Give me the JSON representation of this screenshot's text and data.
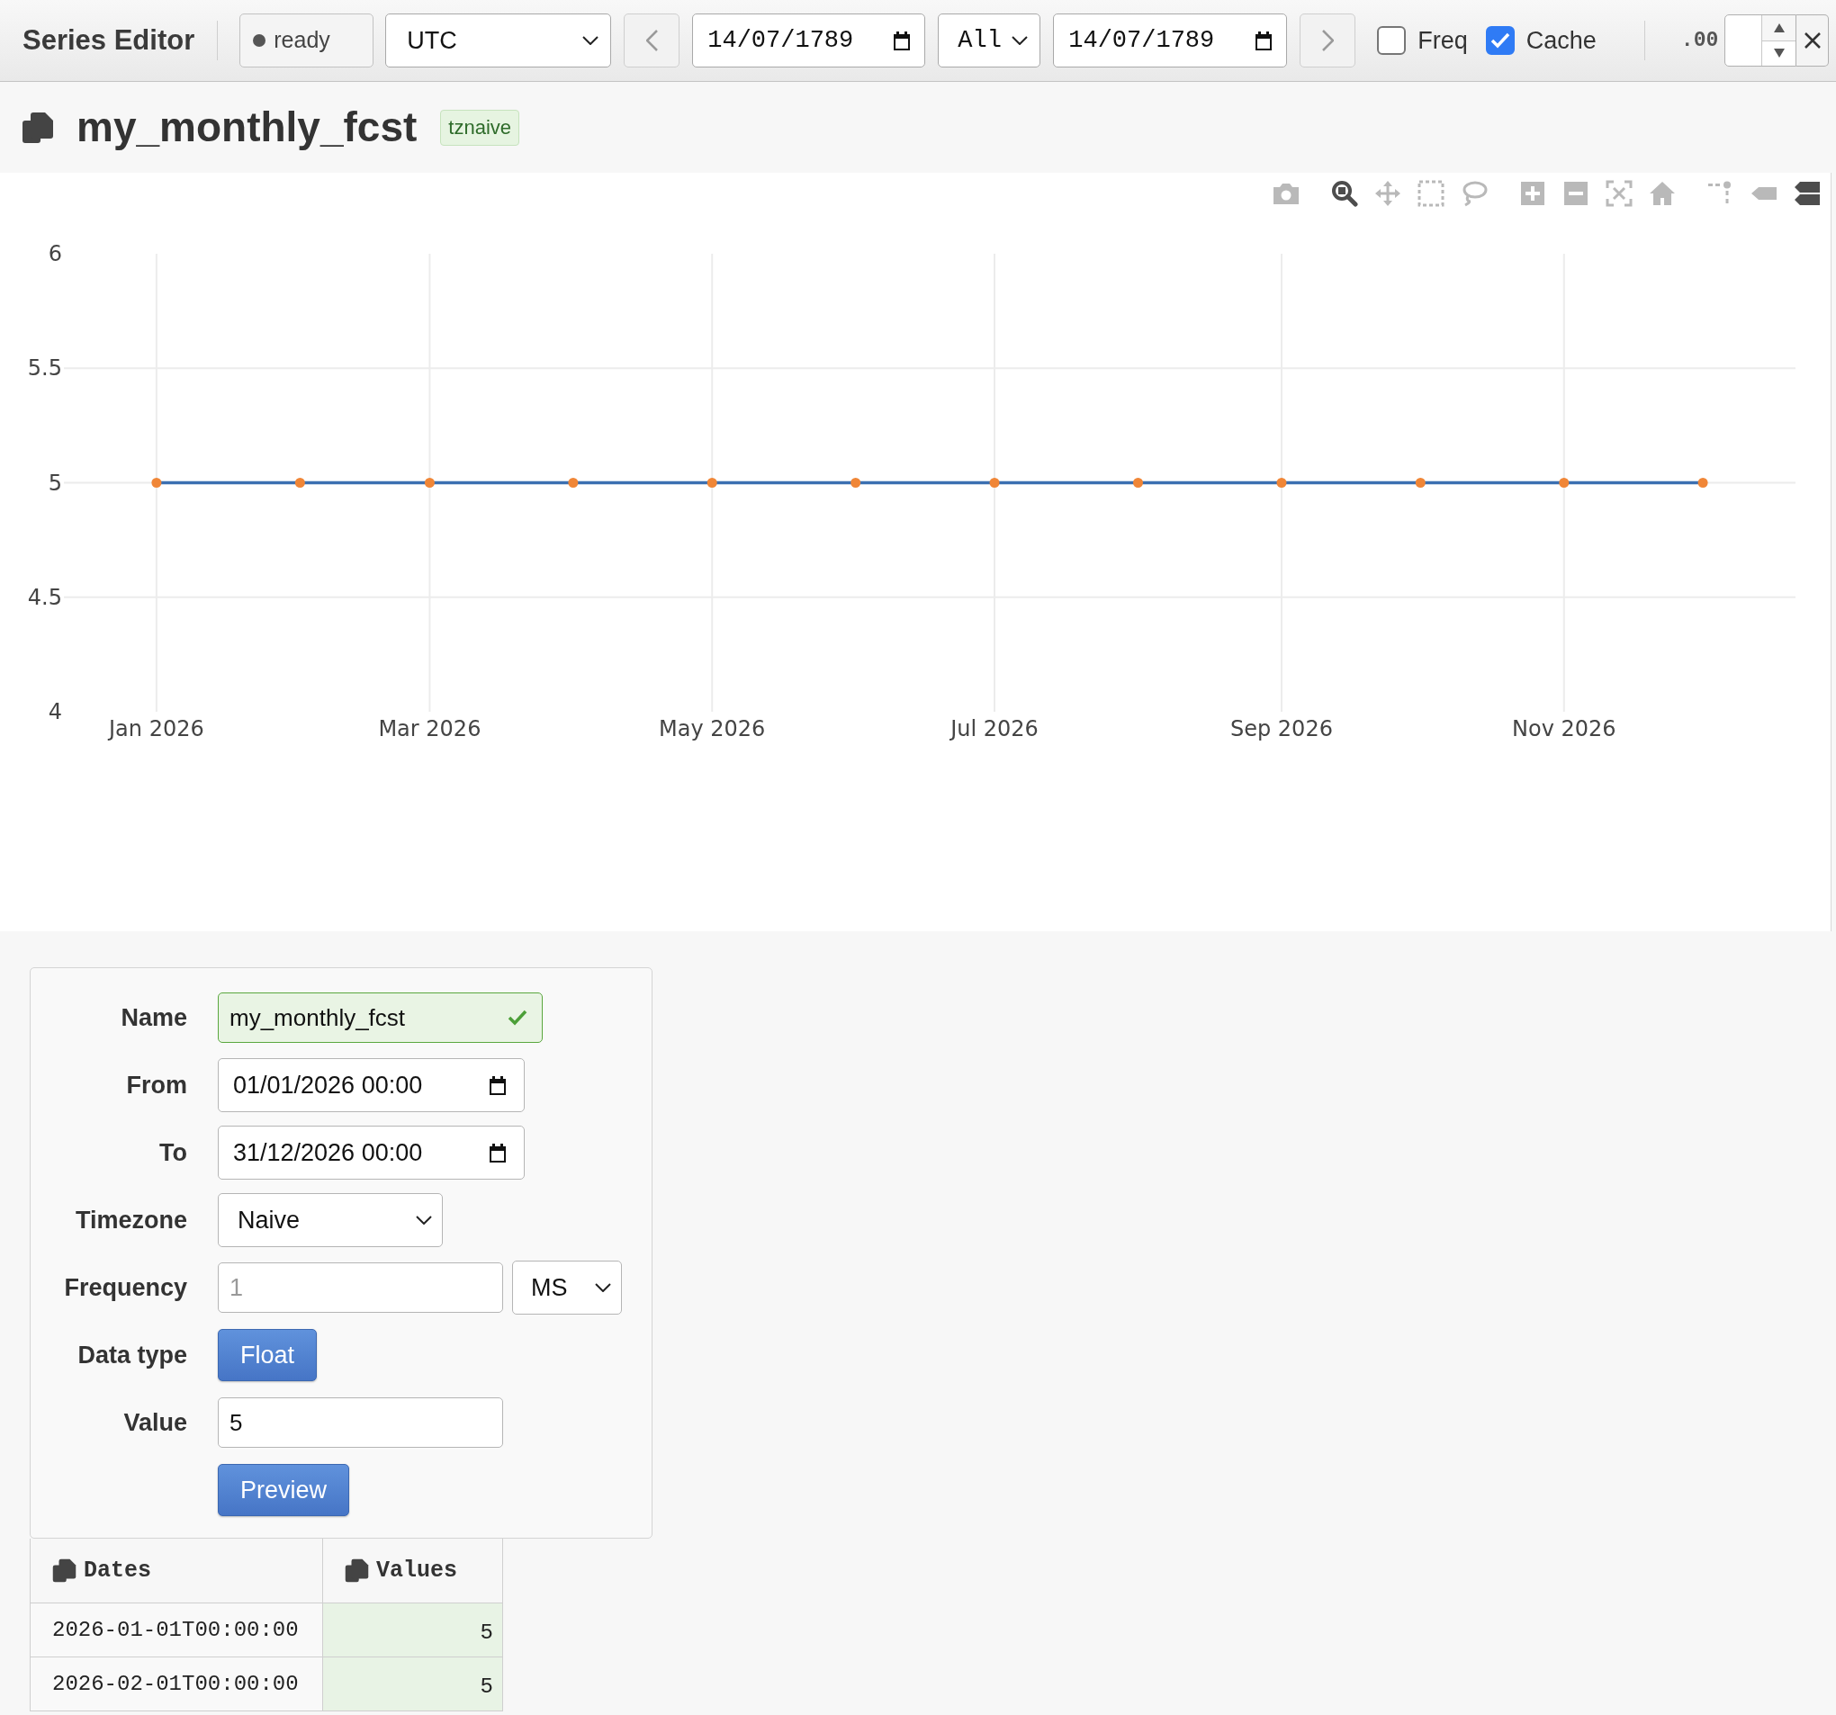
{
  "toolbar": {
    "title": "Series Editor",
    "status": "ready",
    "timezone": "UTC",
    "start_date": "14/07/1789",
    "range": "All",
    "end_date": "14/07/1789",
    "checkboxes": [
      {
        "label": "Freq",
        "checked": false
      },
      {
        "label": "Cache",
        "checked": true
      }
    ],
    "precision": ".00"
  },
  "series": {
    "name": "my_monthly_fcst",
    "badge": "tznaive"
  },
  "chart": {
    "modebar": [
      {
        "buttons": [
          {
            "kind": "camera",
            "selected": false
          }
        ]
      },
      {
        "buttons": [
          {
            "kind": "zoom",
            "selected": true
          },
          {
            "kind": "pan",
            "selected": false
          },
          {
            "kind": "box_select",
            "selected": false
          },
          {
            "kind": "lasso",
            "selected": false
          }
        ]
      },
      {
        "buttons": [
          {
            "kind": "zoom_in",
            "selected": false
          },
          {
            "kind": "zoom_out",
            "selected": false
          },
          {
            "kind": "autoscale",
            "selected": false
          },
          {
            "kind": "home",
            "selected": false
          }
        ]
      },
      {
        "buttons": [
          {
            "kind": "spikelines",
            "selected": false
          },
          {
            "kind": "hover_closest",
            "selected": false
          },
          {
            "kind": "hover_compare",
            "selected": true
          }
        ]
      }
    ],
    "chart_data": {
      "type": "line",
      "x": [
        "2026-01-01",
        "2026-02-01",
        "2026-03-01",
        "2026-04-01",
        "2026-05-01",
        "2026-06-01",
        "2026-07-01",
        "2026-08-01",
        "2026-09-01",
        "2026-10-01",
        "2026-11-01",
        "2026-12-01"
      ],
      "series": [
        {
          "color": "#3b6fb1",
          "marker": {
            "color": "#f08637"
          },
          "values": [
            5,
            5,
            5,
            5,
            5,
            5,
            5,
            5,
            5,
            5,
            5,
            5
          ]
        }
      ],
      "xlim": [
        "2025-12-12",
        "2026-12-21"
      ],
      "ylim": [
        4,
        6
      ],
      "xticks": [
        {
          "value": "2026-01-01",
          "label": "Jan 2026"
        },
        {
          "value": "2026-03-01",
          "label": "Mar 2026"
        },
        {
          "value": "2026-05-01",
          "label": "May 2026"
        },
        {
          "value": "2026-07-01",
          "label": "Jul 2026"
        },
        {
          "value": "2026-09-01",
          "label": "Sep 2026"
        },
        {
          "value": "2026-11-01",
          "label": "Nov 2026"
        }
      ],
      "yticks": [
        4,
        4.5,
        5,
        5.5,
        6
      ],
      "grid": true
    }
  },
  "form": {
    "fields": [
      {
        "label": "Name",
        "kind": "text",
        "value": "my_monthly_fcst",
        "valid": true
      },
      {
        "label": "From",
        "kind": "datetime",
        "value": "01/01/2026 00:00"
      },
      {
        "label": "To",
        "kind": "datetime",
        "value": "31/12/2026 00:00"
      },
      {
        "label": "Timezone",
        "kind": "select",
        "value": "Naive"
      },
      {
        "label": "Frequency",
        "kind": "number_unit",
        "placeholder": "1",
        "unit": "MS"
      },
      {
        "label": "Data type",
        "kind": "button",
        "value": "Float"
      },
      {
        "label": "Value",
        "kind": "text",
        "value": "5",
        "valid": false
      }
    ],
    "submit": "Preview"
  },
  "table": {
    "columns": [
      "Dates",
      "Values"
    ],
    "rows": [
      [
        "2026-01-01T00:00:00",
        "5"
      ],
      [
        "2026-02-01T00:00:00",
        "5"
      ]
    ]
  }
}
